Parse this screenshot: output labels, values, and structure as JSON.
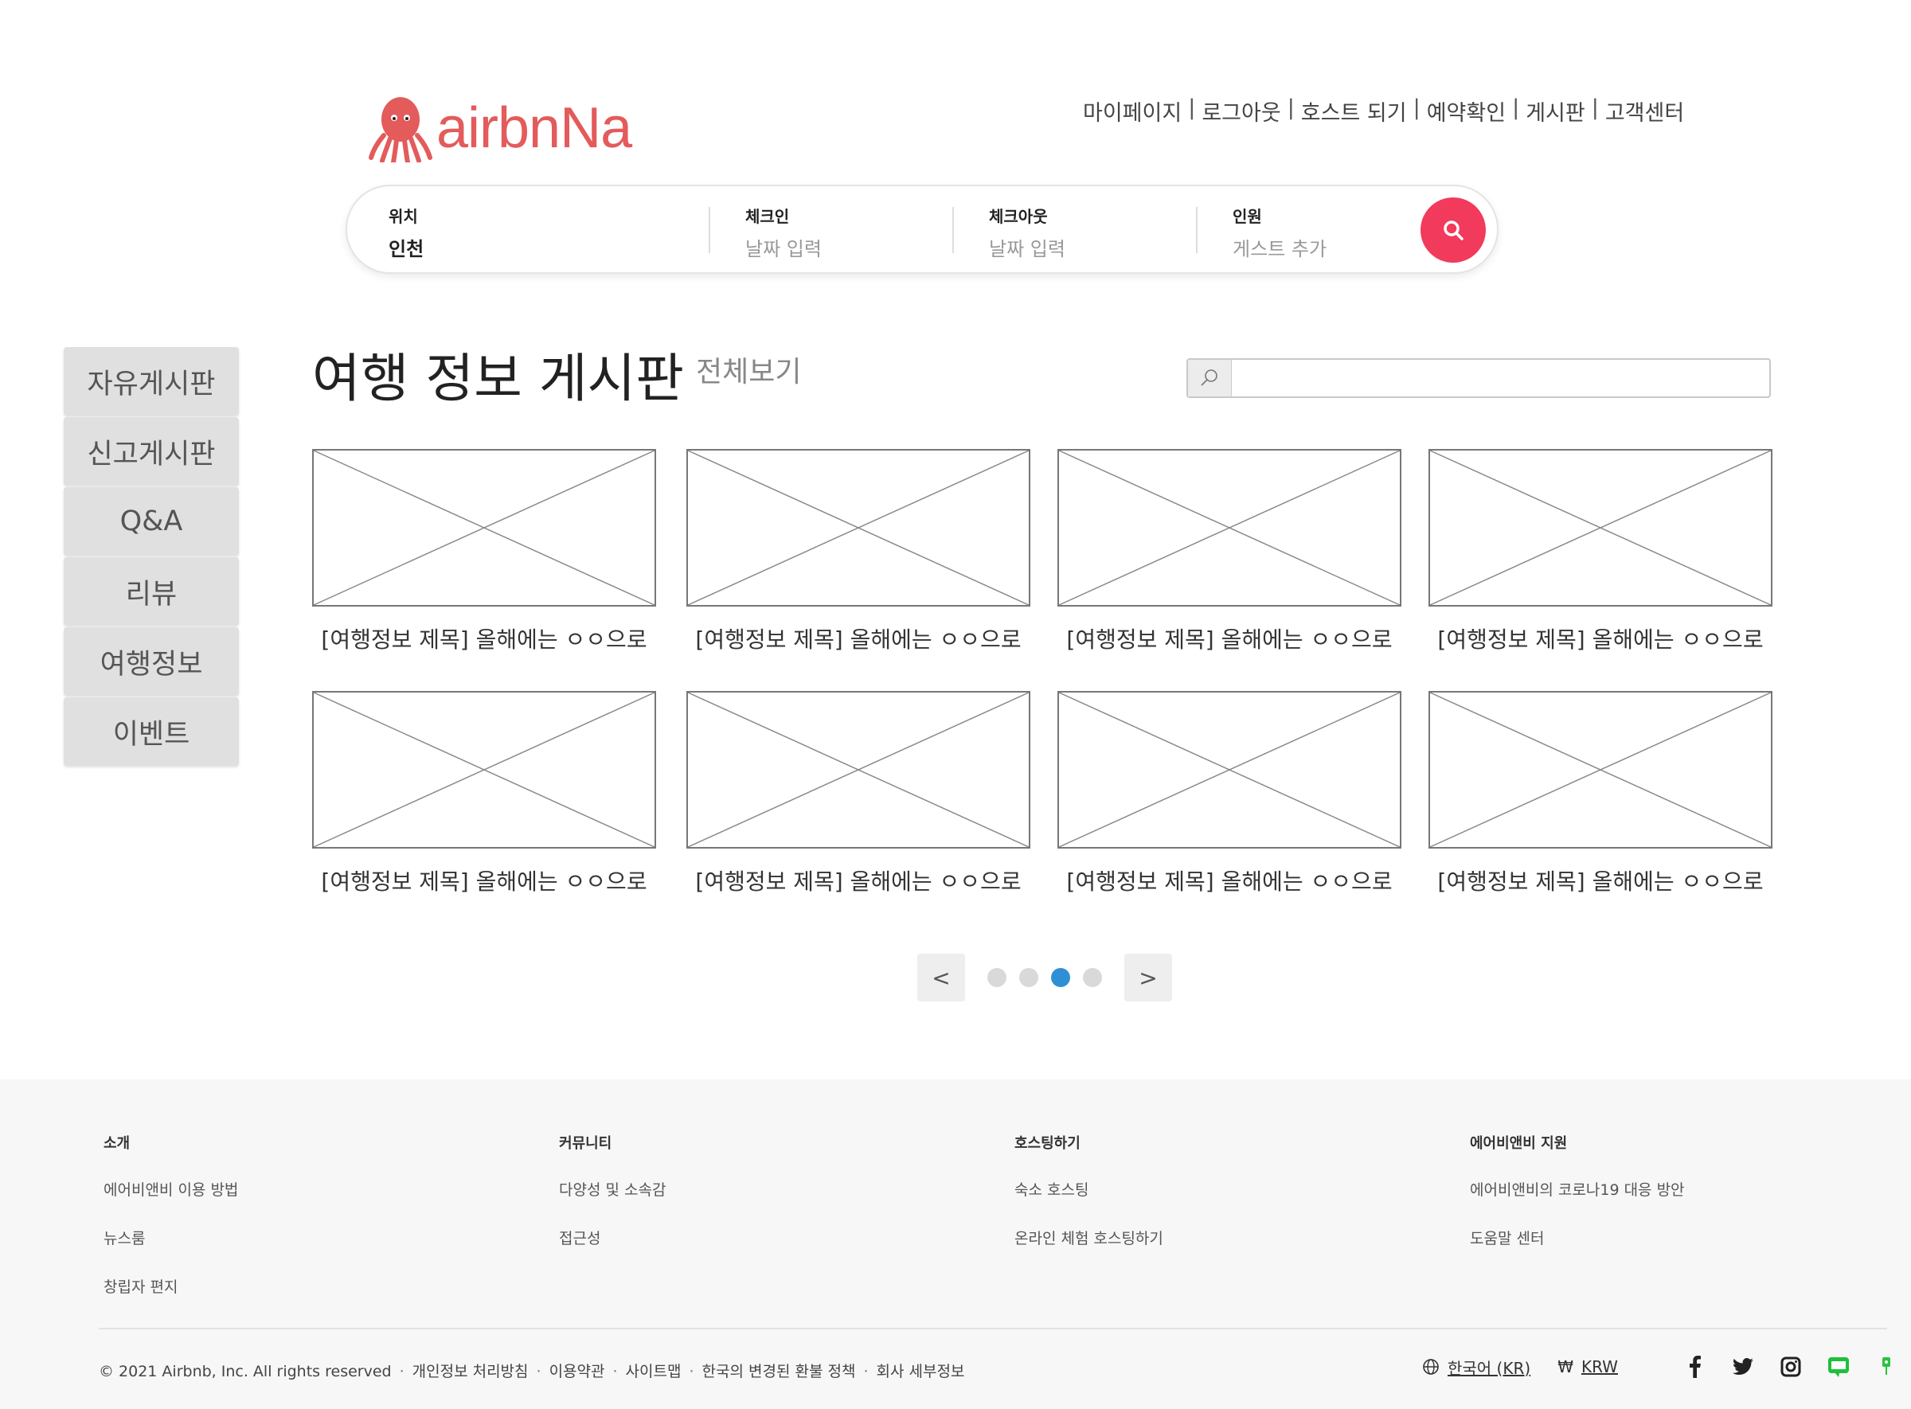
{
  "header": {
    "logo_text": "airbnNa",
    "nav": [
      "마이페이지",
      "로그아웃",
      "호스트 되기",
      "예약확인",
      "게시판",
      "고객센터"
    ],
    "nav_separator": "|"
  },
  "search": {
    "location_label": "위치",
    "location_value": "인천",
    "checkin_label": "체크인",
    "checkin_value": "날짜 입력",
    "checkout_label": "체크아웃",
    "checkout_value": "날짜 입력",
    "guests_label": "인원",
    "guests_value": "게스트 추가",
    "button_color": "#f23a5c"
  },
  "sidebar": {
    "items": [
      {
        "label": "자유게시판"
      },
      {
        "label": "신고게시판"
      },
      {
        "label": "Q&A"
      },
      {
        "label": "리뷰"
      },
      {
        "label": "여행정보"
      },
      {
        "label": "이벤트"
      }
    ]
  },
  "board": {
    "title": "여행 정보 게시판",
    "view_all": "전체보기",
    "search_placeholder": "",
    "cards": [
      {
        "title": "[여행정보 제목] 올해에는 ㅇㅇ으로"
      },
      {
        "title": "[여행정보 제목] 올해에는 ㅇㅇ으로"
      },
      {
        "title": "[여행정보 제목] 올해에는 ㅇㅇ으로"
      },
      {
        "title": "[여행정보 제목] 올해에는 ㅇㅇ으로"
      },
      {
        "title": "[여행정보 제목] 올해에는 ㅇㅇ으로"
      },
      {
        "title": "[여행정보 제목] 올해에는 ㅇㅇ으로"
      },
      {
        "title": "[여행정보 제목] 올해에는 ㅇㅇ으로"
      },
      {
        "title": "[여행정보 제목] 올해에는 ㅇㅇ으로"
      }
    ]
  },
  "pagination": {
    "prev": "<",
    "next": ">",
    "page_count": 4,
    "current_page": 3,
    "active_color": "#2f8fd6"
  },
  "footer": {
    "columns": [
      {
        "heading": "소개",
        "links": [
          "에어비앤비 이용 방법",
          "뉴스룸",
          "창립자 편지"
        ]
      },
      {
        "heading": "커뮤니티",
        "links": [
          "다양성 및 소속감",
          "접근성"
        ]
      },
      {
        "heading": "호스팅하기",
        "links": [
          "숙소 호스팅",
          "온라인 체험 호스팅하기"
        ]
      },
      {
        "heading": "에어비앤비 지원",
        "links": [
          "에어비앤비의 코로나19 대응 방안",
          "도움말 센터"
        ]
      }
    ],
    "copyright": "© 2021 Airbnb, Inc. All rights reserved",
    "legal_links": [
      "개인정보 처리방침",
      "이용약관",
      "사이트맵",
      "한국의 변경된 환불 정책",
      "회사 세부정보"
    ],
    "language": "한국어 (KR)",
    "currency_symbol": "₩",
    "currency": "KRW",
    "social_icons": [
      "facebook-icon",
      "twitter-icon",
      "instagram-icon",
      "line-icon",
      "naver-icon"
    ]
  }
}
